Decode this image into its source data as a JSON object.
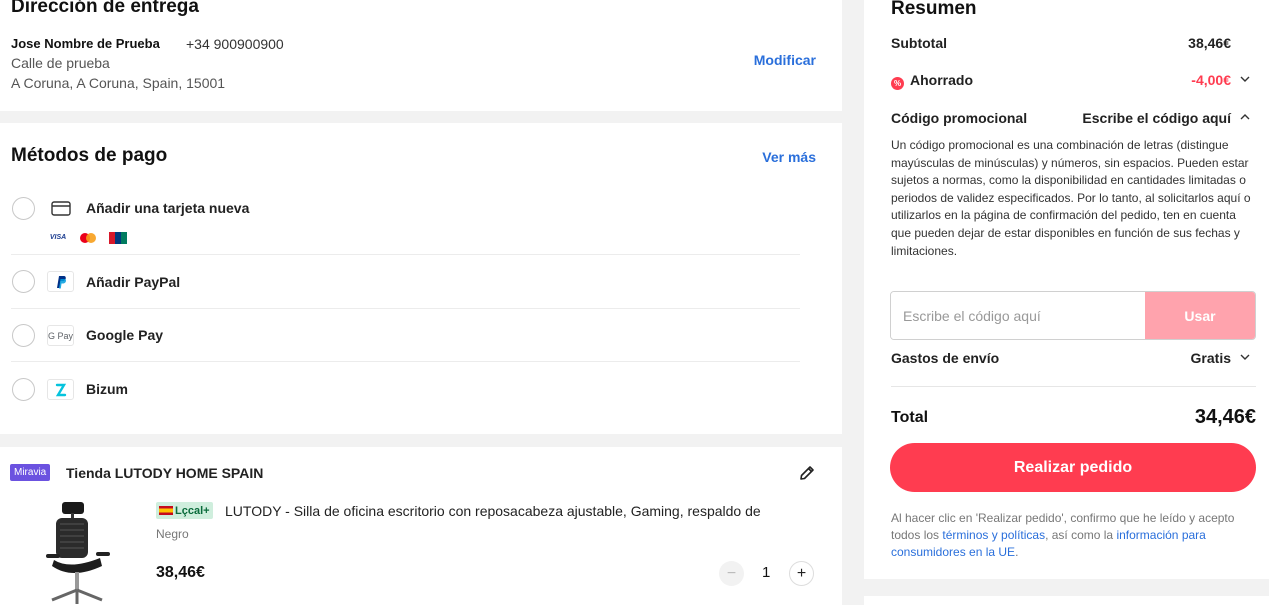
{
  "delivery": {
    "title": "Dirección de entrega",
    "name": "Jose Nombre de Prueba",
    "phone": "+34 900900900",
    "street": "Calle de prueba",
    "city": "A Coruna, A Coruna, Spain, 15001",
    "modify_label": "Modificar"
  },
  "payment": {
    "title": "Métodos de pago",
    "more_label": "Ver más",
    "methods": [
      {
        "label": "Añadir una tarjeta nueva",
        "icon": "credit-card-icon"
      },
      {
        "label": "Añadir PayPal",
        "icon": "paypal-icon"
      },
      {
        "label": "Google Pay",
        "icon": "google-pay-icon",
        "icon_text": "G Pay"
      },
      {
        "label": "Bizum",
        "icon": "bizum-icon"
      }
    ],
    "card_logos": [
      "VISA",
      "mastercard",
      "UnionPay"
    ]
  },
  "store": {
    "badge": "Miravia",
    "name": "Tienda LUTODY HOME SPAIN",
    "product": {
      "tag": "Lçcal+",
      "title": "LUTODY - Silla de oficina escritorio con reposacabeza ajustable, Gaming, respaldo de",
      "variant": "Negro",
      "price": "38,46€",
      "quantity": "1",
      "minus": "−",
      "plus": "+"
    }
  },
  "summary": {
    "title": "Resumen",
    "subtotal_label": "Subtotal",
    "subtotal_value": "38,46€",
    "saved_label": "Ahorrado",
    "saved_icon_text": "%",
    "saved_value": "-4,00€",
    "promo_label": "Código promocional",
    "promo_action": "Escribe el código aquí",
    "promo_description": "Un código promocional es una combinación de letras (distingue mayúsculas de minúsculas) y números, sin espacios. Pueden estar sujetos a normas, como la disponibilidad en cantidades limitadas o periodos de validez especificados. Por lo tanto, al solicitarlos aquí o utilizarlos en la página de confirmación del pedido, ten en cuenta que pueden dejar de estar disponibles en función de sus fechas y limitaciones.",
    "promo_placeholder": "Escribe el código aquí",
    "use_label": "Usar",
    "shipping_label": "Gastos de envío",
    "shipping_value": "Gratis",
    "total_label": "Total",
    "total_value": "34,46€",
    "order_label": "Realizar pedido",
    "legal_1": "Al hacer clic en 'Realizar pedido', confirmo que he leído y acepto todos los ",
    "legal_link_1": "términos y políticas",
    "legal_2": ", así como la ",
    "legal_link_2": "información para consumidores en la UE",
    "legal_3": "."
  },
  "colors": {
    "accent": "#ff3c50",
    "accent_disabled": "#ffa3ad",
    "link": "#2a6fdb",
    "badge": "#6b52e0"
  }
}
